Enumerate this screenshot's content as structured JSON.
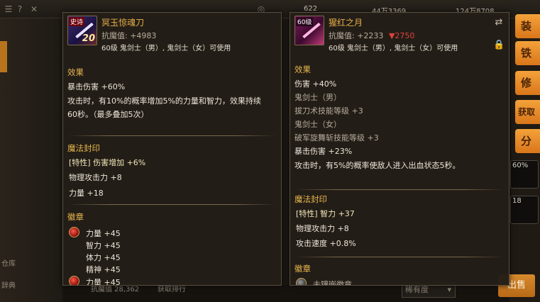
{
  "top_bar": {
    "stat_1": "622",
    "stat_2": "44万3369",
    "stat_3": "124万8708"
  },
  "left_sidebar": {
    "label_warehouse": "仓库",
    "label_dict": "辞典"
  },
  "right_sidebar": {
    "buttons": [
      "装",
      "铁",
      "修",
      "获取",
      "分"
    ],
    "slot_60": "60%",
    "slot_18": "18"
  },
  "bottom": {
    "stat_a": "抗魔值 28,362",
    "stat_b": "获取排行",
    "sort_select": "稀有度",
    "sell_button": "出售"
  },
  "left_item": {
    "badge": "史诗",
    "enhance": "20",
    "name": "冥玉惊魂刀",
    "resist_label": "抗魔值:",
    "resist_value": "+4983",
    "requirement": "60级 鬼剑士（男）, 鬼剑士（女）可使用",
    "effect_header": "效果",
    "effect_lines": [
      "暴击伤害 +60%",
      "攻击时，有10%的概率增加5%的力量和智力，效果持续",
      "60秒。（最多叠加5次）"
    ],
    "seal_header": "魔法封印",
    "seal_lines": [
      "[特性] 伤害增加 +6%",
      "物理攻击力 +8",
      "力量 +18"
    ],
    "emblem_header": "徽章",
    "emblem_lines": [
      "力量 +45",
      "智力 +45",
      "体力 +45",
      "精神 +45",
      "力量 +45"
    ]
  },
  "right_item": {
    "badge": "60级",
    "name": "猩红之月",
    "resist_label": "抗魔值:",
    "resist_value": "+2233",
    "resist_diff": "▼2750",
    "requirement": "60级 鬼剑士（男）, 鬼剑士（女）可使用",
    "effect_header": "效果",
    "effect_lines": [
      "伤害 +40%",
      "鬼剑士（男）",
      "拔刀术技能等级 +3",
      "鬼剑士（女）",
      "破军旋舞斩技能等级 +3",
      "暴击伤害 +23%",
      "攻击时，有5%的概率使敌人进入出血状态5秒。"
    ],
    "seal_header": "魔法封印",
    "seal_lines": [
      "[特性] 智力 +37",
      "物理攻击力 +8",
      "攻击速度 +0.8%"
    ],
    "emblem_header": "徽章",
    "emblem_lines": [
      "未镶嵌徽章"
    ]
  }
}
